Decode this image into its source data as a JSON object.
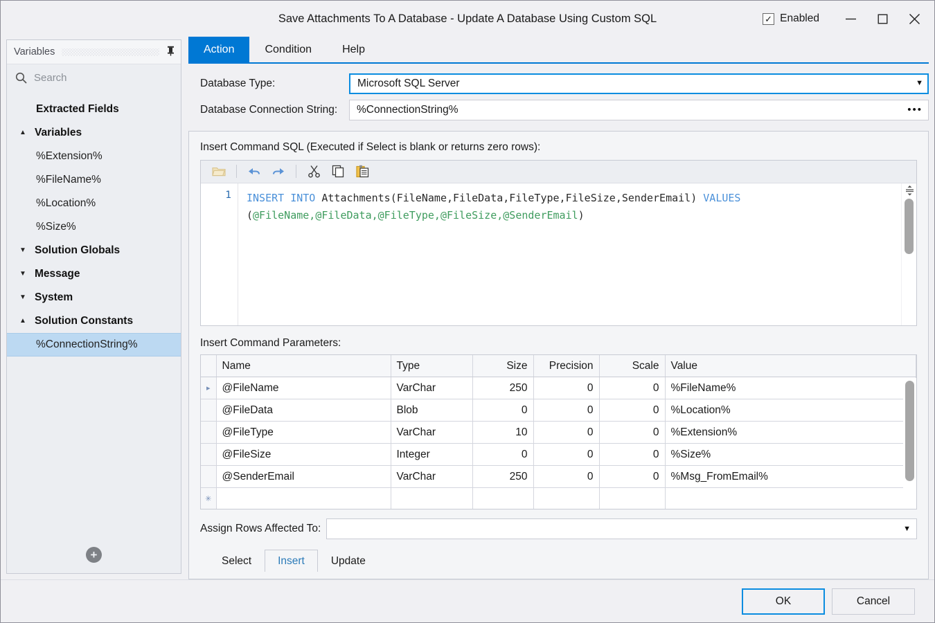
{
  "window": {
    "title": "Save Attachments To A Database - Update A Database Using Custom SQL",
    "enabled_label": "Enabled",
    "enabled_checked": true,
    "check_glyph": "✓",
    "minimize_icon": "minimize-icon",
    "maximize_icon": "maximize-icon",
    "close_icon": "close-icon"
  },
  "sidebar": {
    "panel_title": "Variables",
    "pin_glyph": "⍠",
    "search_placeholder": "Search",
    "search_value": "",
    "tree": [
      {
        "label": "Extracted Fields",
        "type": "group",
        "arrow": "",
        "selected": false
      },
      {
        "label": "Variables",
        "type": "group",
        "arrow": "▲",
        "selected": false
      },
      {
        "label": "%Extension%",
        "type": "leaf",
        "arrow": "",
        "selected": false
      },
      {
        "label": "%FileName%",
        "type": "leaf",
        "arrow": "",
        "selected": false
      },
      {
        "label": "%Location%",
        "type": "leaf",
        "arrow": "",
        "selected": false
      },
      {
        "label": "%Size%",
        "type": "leaf",
        "arrow": "",
        "selected": false
      },
      {
        "label": "Solution Globals",
        "type": "group",
        "arrow": "▼",
        "selected": false
      },
      {
        "label": "Message",
        "type": "group",
        "arrow": "▼",
        "selected": false
      },
      {
        "label": "System",
        "type": "group",
        "arrow": "▼",
        "selected": false
      },
      {
        "label": "Solution Constants",
        "type": "group",
        "arrow": "▲",
        "selected": false
      },
      {
        "label": "%ConnectionString%",
        "type": "leaf",
        "arrow": "",
        "selected": true
      }
    ],
    "add_button_glyph": "+"
  },
  "tabs": [
    {
      "label": "Action",
      "active": true
    },
    {
      "label": "Condition",
      "active": false
    },
    {
      "label": "Help",
      "active": false
    }
  ],
  "form": {
    "database_type_label": "Database Type:",
    "database_type_value": "Microsoft SQL Server",
    "connection_string_label": "Database Connection String:",
    "connection_string_value": "%ConnectionString%",
    "browse_glyph": "•••",
    "caret_glyph": "▼"
  },
  "sql_section": {
    "label": "Insert Command SQL (Executed if Select is blank or returns zero rows):",
    "toolbar": [
      {
        "name": "open-file-icon"
      },
      {
        "name": "undo-icon"
      },
      {
        "name": "redo-icon"
      },
      {
        "name": "cut-icon"
      },
      {
        "name": "copy-icon"
      },
      {
        "name": "paste-icon"
      }
    ],
    "line_number": "1",
    "code_tokens": [
      {
        "text": "INSERT INTO ",
        "kind": "kw"
      },
      {
        "text": "Attachments(FileName,FileData,FileType,FileSize,SenderEmail) ",
        "kind": "plain"
      },
      {
        "text": "VALUES",
        "kind": "kw"
      },
      {
        "text": "\n(",
        "kind": "plain"
      },
      {
        "text": "@FileName,@FileData,@FileType,@FileSize,@SenderEmail",
        "kind": "param"
      },
      {
        "text": ")",
        "kind": "plain"
      }
    ]
  },
  "params": {
    "label": "Insert Command Parameters:",
    "columns": [
      "",
      "Name",
      "Type",
      "Size",
      "Precision",
      "Scale",
      "Value"
    ],
    "rows": [
      {
        "marker": "▸",
        "name": "@FileName",
        "type": "VarChar",
        "size": "250",
        "precision": "0",
        "scale": "0",
        "value": "%FileName%"
      },
      {
        "marker": "",
        "name": "@FileData",
        "type": "Blob",
        "size": "0",
        "precision": "0",
        "scale": "0",
        "value": "%Location%"
      },
      {
        "marker": "",
        "name": "@FileType",
        "type": "VarChar",
        "size": "10",
        "precision": "0",
        "scale": "0",
        "value": "%Extension%"
      },
      {
        "marker": "",
        "name": "@FileSize",
        "type": "Integer",
        "size": "0",
        "precision": "0",
        "scale": "0",
        "value": "%Size%"
      },
      {
        "marker": "",
        "name": "@SenderEmail",
        "type": "VarChar",
        "size": "250",
        "precision": "0",
        "scale": "0",
        "value": "%Msg_FromEmail%"
      },
      {
        "marker": "✳",
        "name": "",
        "type": "",
        "size": "",
        "precision": "",
        "scale": "",
        "value": ""
      }
    ]
  },
  "assign": {
    "label": "Assign Rows Affected To:",
    "value": "",
    "caret_glyph": "▼"
  },
  "subtabs": [
    {
      "label": "Select",
      "active": false
    },
    {
      "label": "Insert",
      "active": true
    },
    {
      "label": "Update",
      "active": false
    }
  ],
  "footer": {
    "ok_label": "OK",
    "cancel_label": "Cancel"
  },
  "colors": {
    "accent": "#0078d4",
    "field_focus_border": "#0a8ce0",
    "selection": "#bcd9f2",
    "keyword": "#4a90d9",
    "param": "#3f9c5e",
    "window_bg": "#f0f0f3"
  }
}
